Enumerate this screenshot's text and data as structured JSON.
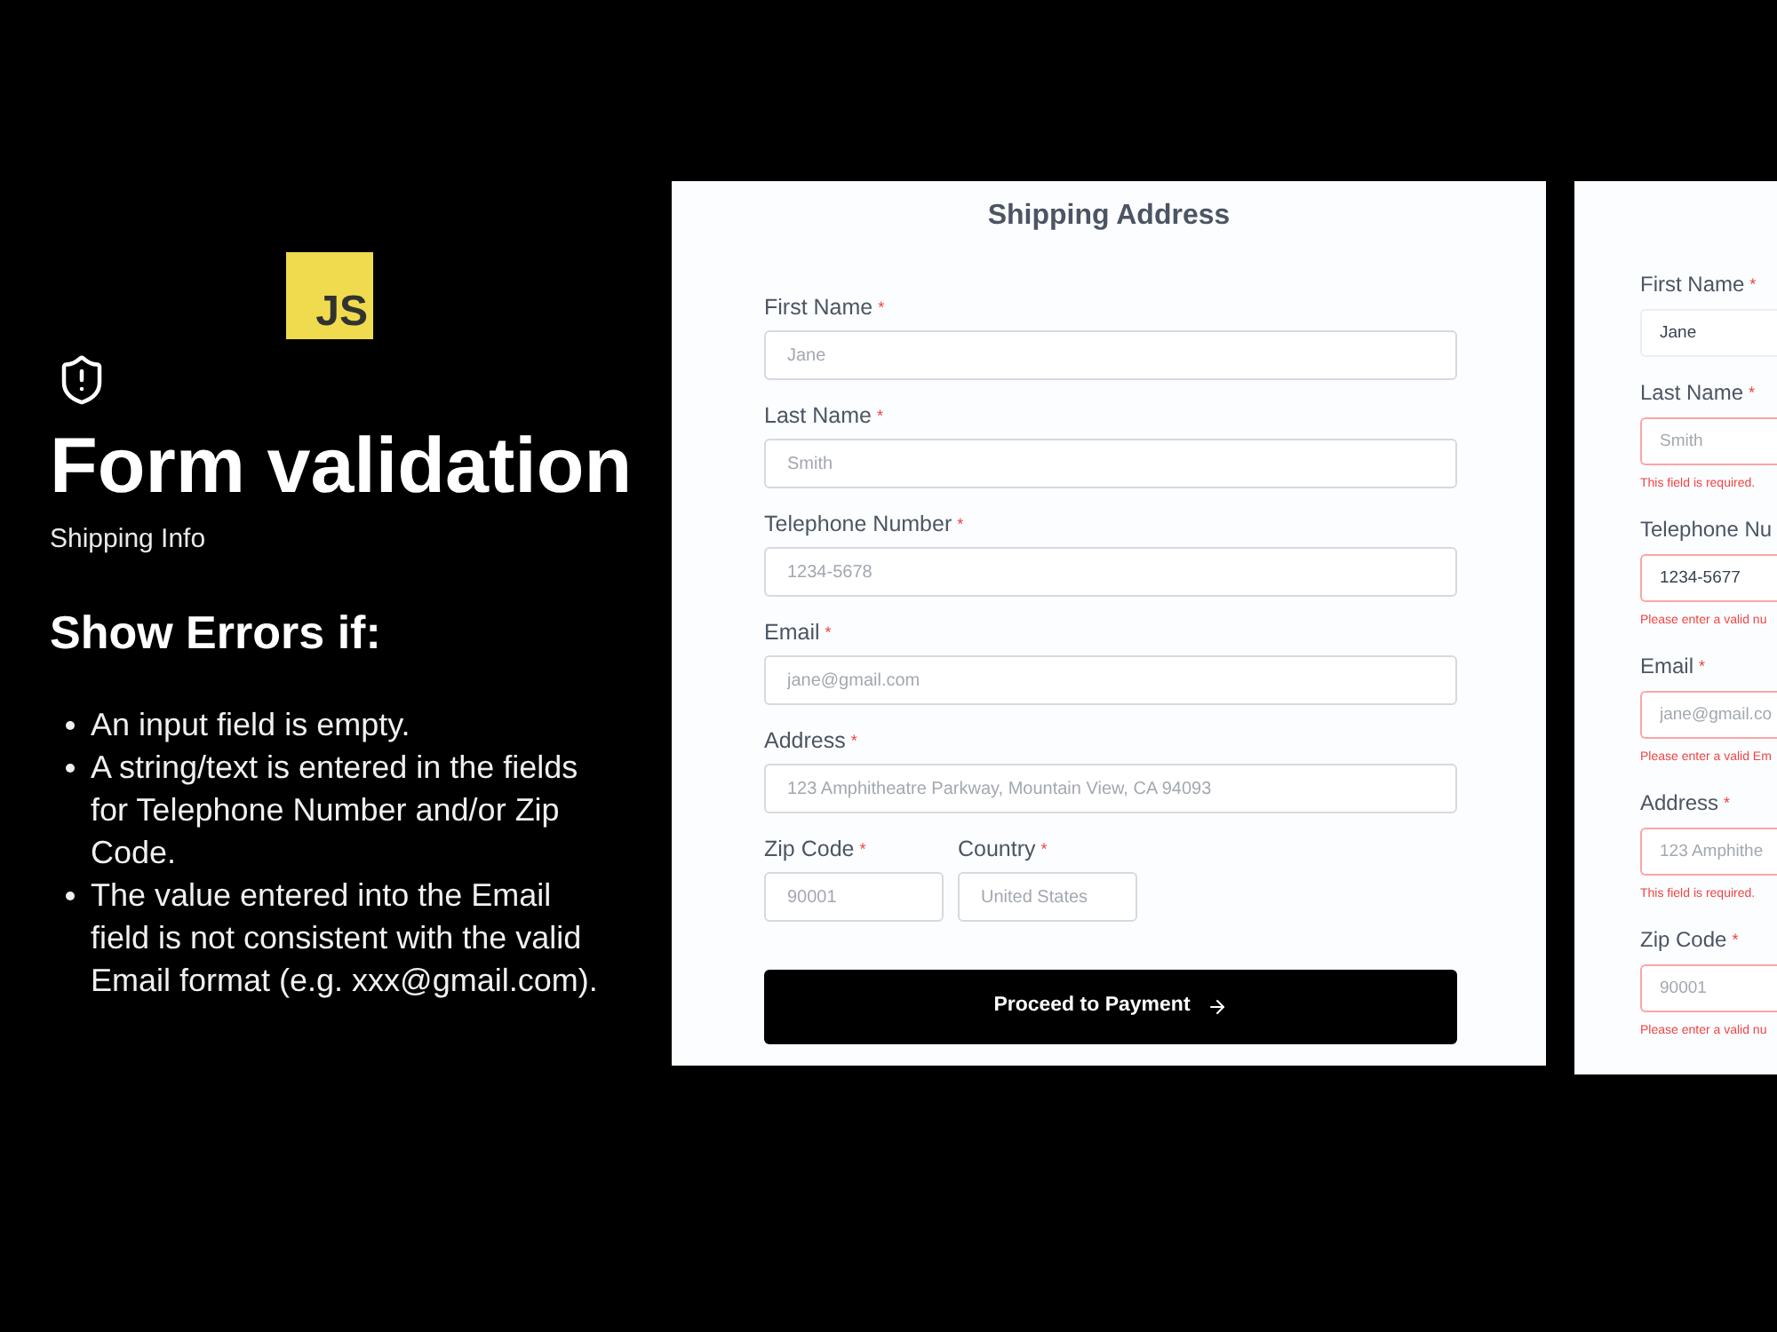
{
  "logo": {
    "text": "JS"
  },
  "intro": {
    "title": "Form validation",
    "subtitle": "Shipping Info",
    "heading": "Show Errors if:",
    "rules": [
      "An input field is empty.",
      "A string/text is entered in the fields for Telephone Number and/or Zip Code.",
      "The value entered into the Email field is not consistent with the valid Email format (e.g. xxx@gmail.com)."
    ]
  },
  "forms": [
    {
      "title": "Shipping Address",
      "fields": [
        {
          "label": "First Name",
          "required_mark": "*",
          "placeholder": "Jane"
        },
        {
          "label": "Last Name",
          "required_mark": "*",
          "placeholder": "Smith"
        },
        {
          "label": "Telephone Number",
          "required_mark": "*",
          "placeholder": "1234-5678"
        },
        {
          "label": "Email",
          "required_mark": "*",
          "placeholder": "jane@gmail.com"
        },
        {
          "label": "Address",
          "required_mark": "*",
          "placeholder": "123 Amphitheatre Parkway, Mountain View, CA 94093"
        }
      ],
      "inline_fields": [
        {
          "label": "Zip Code",
          "required_mark": "*",
          "placeholder": "90001"
        },
        {
          "label": "Country",
          "required_mark": "*",
          "placeholder": "United States"
        }
      ],
      "button": {
        "label": "Proceed to Payment"
      }
    },
    {
      "fields": [
        {
          "label": "First Name",
          "required_mark": "*",
          "value": "Jane",
          "invalid": false
        },
        {
          "label": "Last Name",
          "required_mark": "*",
          "placeholder": "Smith",
          "invalid": true,
          "error": "This field is required."
        },
        {
          "label": "Telephone Nu",
          "value": "1234-5677",
          "invalid": true,
          "error": "Please enter a valid nu"
        },
        {
          "label": "Email",
          "required_mark": "*",
          "placeholder": "jane@gmail.co",
          "invalid": true,
          "error": "Please enter a valid Em"
        },
        {
          "label": "Address",
          "required_mark": "*",
          "placeholder": "123 Amphithe",
          "invalid": true,
          "error": "This field is required."
        },
        {
          "label": "Zip Code",
          "required_mark": "*",
          "placeholder": "90001",
          "invalid": true,
          "error": "Please enter a valid nu"
        }
      ]
    }
  ]
}
